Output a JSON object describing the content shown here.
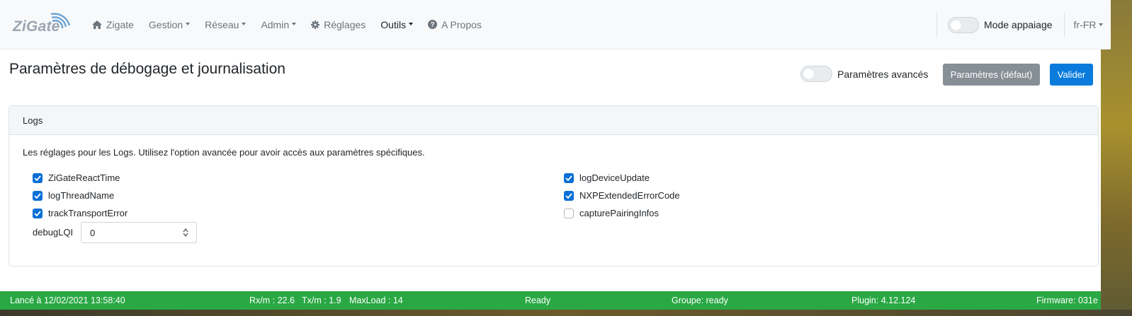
{
  "brand": {
    "logo_text": "ZiGate"
  },
  "nav": {
    "items": [
      {
        "label": "Zigate",
        "icon": "home-icon",
        "caret": false
      },
      {
        "label": "Gestion",
        "caret": true
      },
      {
        "label": "Réseau",
        "caret": true
      },
      {
        "label": "Admin",
        "caret": true
      },
      {
        "label": "Réglages",
        "icon": "gear-icon",
        "caret": false
      },
      {
        "label": "Outils",
        "caret": true,
        "active": true
      },
      {
        "label": "A Propos",
        "icon": "question-circle-icon",
        "caret": false
      }
    ],
    "pairing_mode_label": "Mode appaiage",
    "language": "fr-FR"
  },
  "page": {
    "title": "Paramètres de débogage et journalisation",
    "advanced_label": "Paramètres avancés",
    "default_button": "Paramètres (défaut)",
    "validate_button": "Valider"
  },
  "card": {
    "header": "Logs",
    "description": "Les réglages pour les Logs. Utilisez l'option avancée pour avoir accès aux paramètres spécifiques.",
    "checks": [
      {
        "label": "ZiGateReactTime",
        "checked": true
      },
      {
        "label": "logThreadName",
        "checked": true
      },
      {
        "label": "trackTransportError",
        "checked": true
      },
      {
        "label": "logDeviceUpdate",
        "checked": true
      },
      {
        "label": "NXPExtendedErrorCode",
        "checked": true
      },
      {
        "label": "capturePairingInfos",
        "checked": false
      }
    ],
    "debug_lqi_label": "debugLQI",
    "debug_lqi_value": "0"
  },
  "footer": {
    "started": "Lancé à 12/02/2021 13:58:40",
    "rx": "Rx/m : 22.6",
    "tx": "Tx/m : 1.9",
    "maxload": "MaxLoad : 14",
    "status": "Ready",
    "group": "Groupe: ready",
    "plugin": "Plugin: 4.12.124",
    "firmware": "Firmware: 031e"
  },
  "colors": {
    "primary": "#0a7bdc",
    "secondary": "#868e96",
    "footer": "#2aa844"
  }
}
